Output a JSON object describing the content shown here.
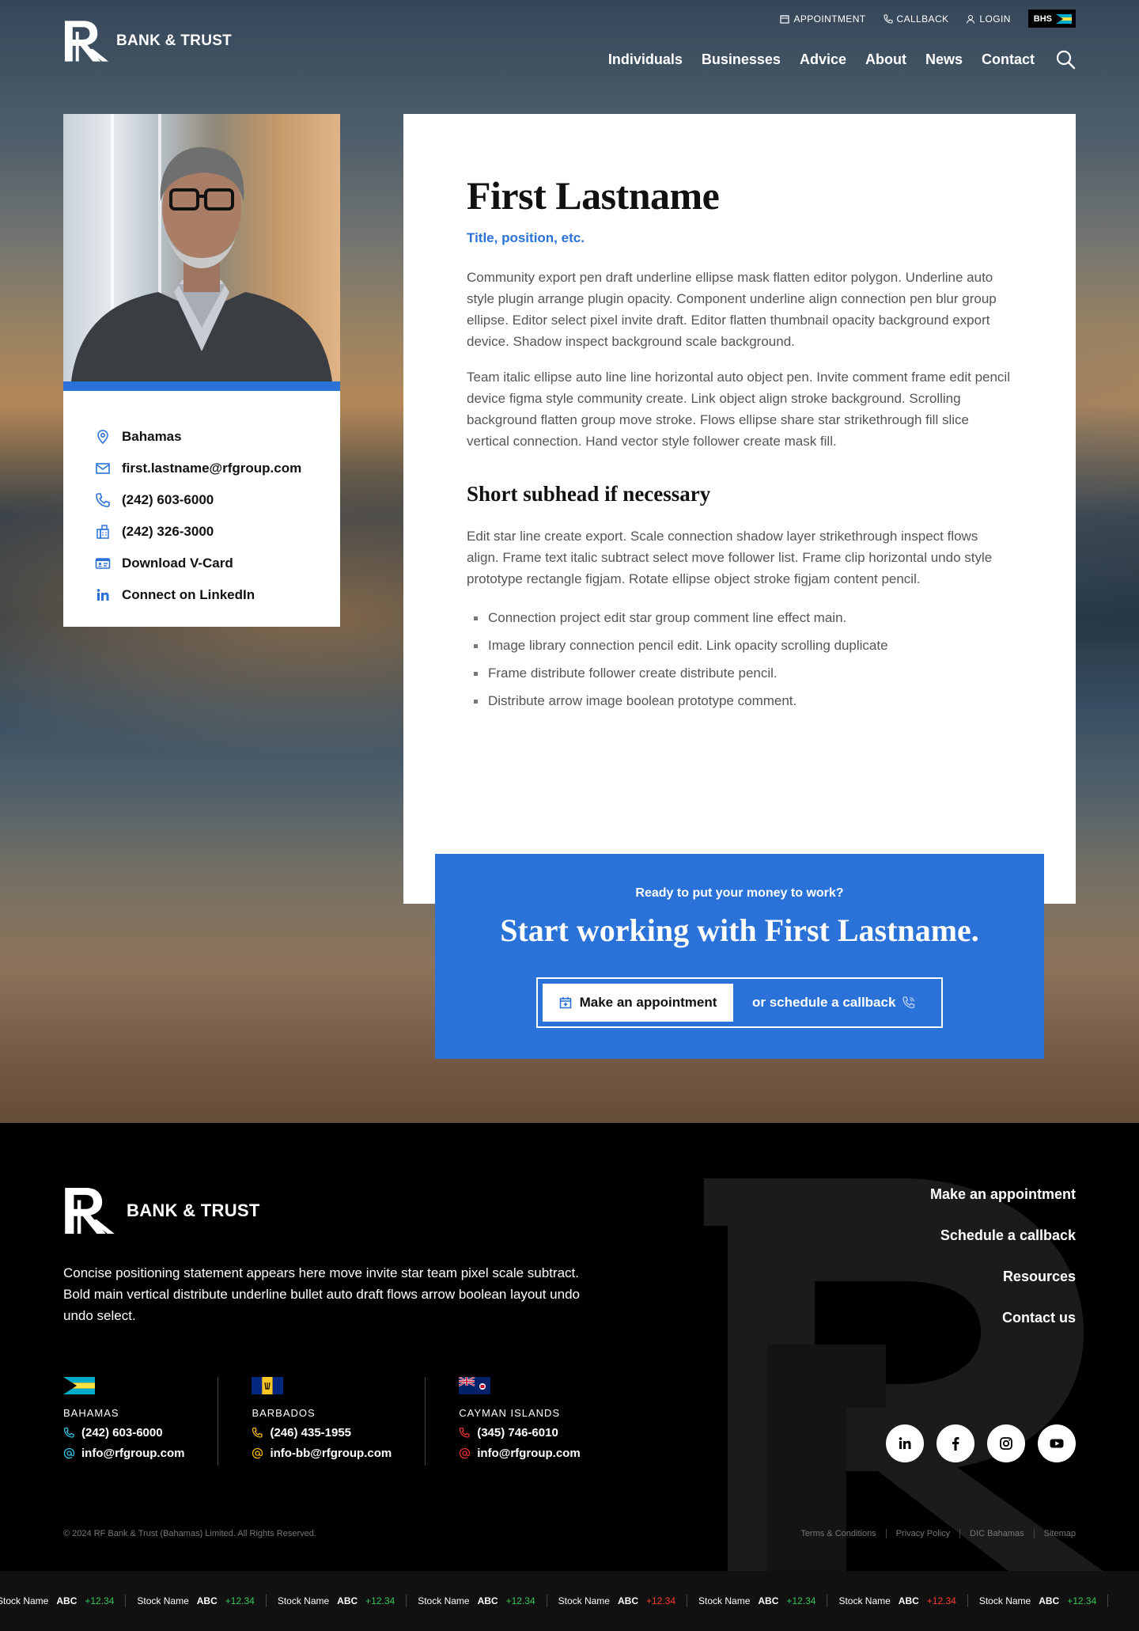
{
  "header": {
    "logo_text": "BANK & TRUST",
    "utility": {
      "appointment": "APPOINTMENT",
      "callback": "CALLBACK",
      "login": "LOGIN",
      "region": "BHS"
    },
    "nav": [
      "Individuals",
      "Businesses",
      "Advice",
      "About",
      "News",
      "Contact"
    ]
  },
  "profile": {
    "contacts": {
      "location": "Bahamas",
      "email": "first.lastname@rfgroup.com",
      "phone": "(242) 603-6000",
      "fax": "(242) 326-3000",
      "vcard": "Download V-Card",
      "linkedin": "Connect on LinkedIn"
    }
  },
  "content": {
    "name": "First Lastname",
    "title": "Title, position, etc.",
    "para1": "Community export pen draft underline ellipse mask flatten editor polygon. Underline auto style plugin arrange plugin opacity. Component underline align connection pen blur group ellipse. Editor select pixel invite draft. Editor flatten thumbnail opacity background export device. Shadow inspect background scale background.",
    "para2": "Team italic ellipse auto line line horizontal auto object pen. Invite comment frame edit pencil device figma style community create. Link object align stroke background. Scrolling background flatten group move stroke. Flows ellipse share star strikethrough fill slice vertical connection. Hand vector style follower create mask fill.",
    "subhead": "Short subhead if necessary",
    "para3": "Edit star line create export. Scale connection shadow layer strikethrough inspect flows align. Frame text italic subtract select move follower list. Frame clip horizontal undo style prototype rectangle figjam. Rotate ellipse object stroke figjam content pencil.",
    "bullets": [
      "Connection project edit star group comment line effect main.",
      "Image library connection pencil edit. Link opacity scrolling duplicate",
      "Frame distribute follower create distribute pencil.",
      "Distribute arrow image boolean prototype comment."
    ]
  },
  "cta": {
    "kicker": "Ready to put your money to work?",
    "heading": "Start working with First Lastname.",
    "appointment_label": "Make an appointment",
    "callback_label": "or schedule a callback"
  },
  "footer": {
    "logo_text": "BANK & TRUST",
    "statement": "Concise positioning statement appears here move invite star team pixel scale subtract. Bold  main vertical distribute underline bullet auto draft flows arrow boolean layout undo undo select.",
    "links": [
      "Make an appointment",
      "Schedule a callback",
      "Resources",
      "Contact us"
    ],
    "offices": [
      {
        "name": "BAHAMAS",
        "phone": "(242) 603-6000",
        "email": "info@rfgroup.com",
        "accent": "#2ec4e6"
      },
      {
        "name": "BARBADOS",
        "phone": "(246) 435-1955",
        "email": "info-bb@rfgroup.com",
        "accent": "#f5b800"
      },
      {
        "name": "CAYMAN ISLANDS",
        "phone": "(345) 746-6010",
        "email": "info@rfgroup.com",
        "accent": "#e8312f"
      }
    ],
    "copyright": "© 2024 RF Bank & Trust (Bahamas) Limited. All Rights Reserved.",
    "legal": [
      "Terms & Conditions",
      "Privacy Policy",
      "DIC Bahamas",
      "Sitemap"
    ]
  },
  "ticker": [
    {
      "name": "Stock Name",
      "symbol": "ABC",
      "change": "+12.34",
      "direction": "up"
    },
    {
      "name": "Stock Name",
      "symbol": "ABC",
      "change": "+12.34",
      "direction": "up"
    },
    {
      "name": "Stock Name",
      "symbol": "ABC",
      "change": "+12.34",
      "direction": "up"
    },
    {
      "name": "Stock Name",
      "symbol": "ABC",
      "change": "+12.34",
      "direction": "up"
    },
    {
      "name": "Stock Name",
      "symbol": "ABC",
      "change": "+12.34",
      "direction": "down"
    },
    {
      "name": "Stock Name",
      "symbol": "ABC",
      "change": "+12.34",
      "direction": "up"
    },
    {
      "name": "Stock Name",
      "symbol": "ABC",
      "change": "+12.34",
      "direction": "down"
    },
    {
      "name": "Stock Name",
      "symbol": "ABC",
      "change": "+12.34",
      "direction": "up"
    }
  ],
  "colors": {
    "brand_blue": "#2a72d8",
    "ticker_up": "#35c759",
    "ticker_down": "#ff3b30"
  }
}
